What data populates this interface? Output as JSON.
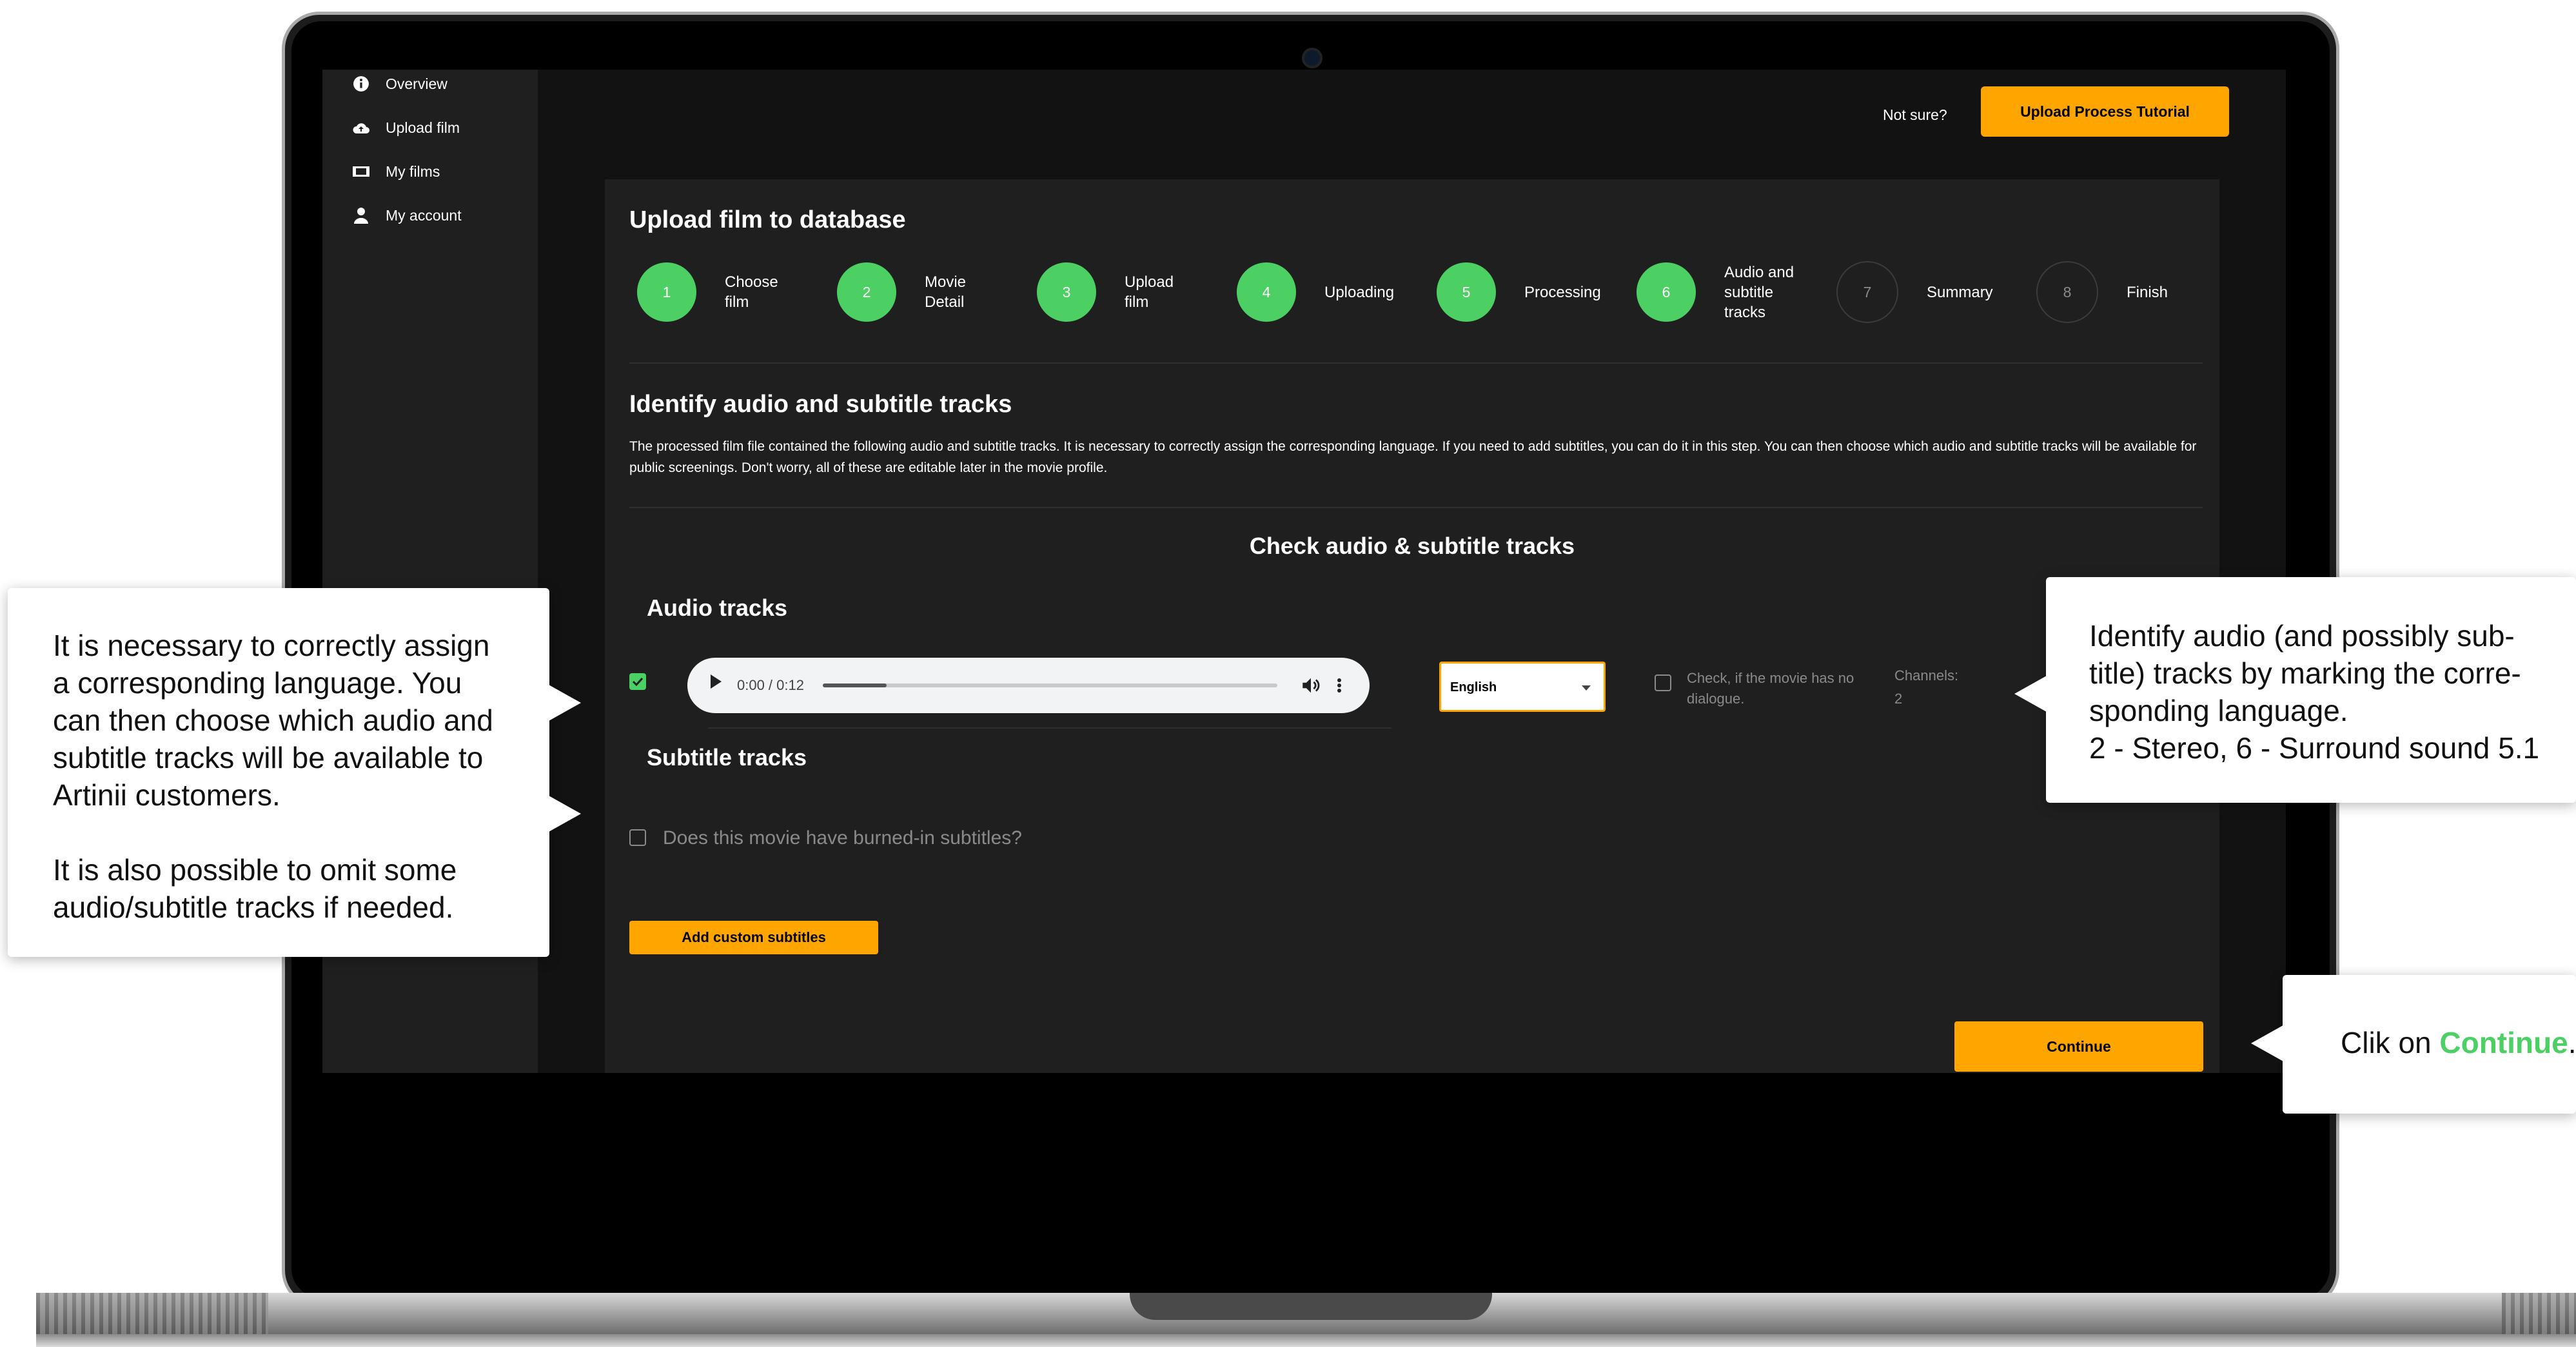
{
  "sidebar": {
    "items": [
      {
        "label": "Overview",
        "icon": "info-icon"
      },
      {
        "label": "Upload film",
        "icon": "cloud-upload-icon"
      },
      {
        "label": "My films",
        "icon": "film-icon"
      },
      {
        "label": "My account",
        "icon": "user-icon"
      }
    ]
  },
  "header": {
    "not_sure": "Not sure?",
    "tutorial_button": "Upload Process Tutorial"
  },
  "panel": {
    "title": "Upload film to database",
    "steps": [
      {
        "number": "1",
        "label": "Choose\nfilm",
        "status": "done"
      },
      {
        "number": "2",
        "label": "Movie\nDetail",
        "status": "done"
      },
      {
        "number": "3",
        "label": "Upload\nfilm",
        "status": "done"
      },
      {
        "number": "4",
        "label": "Uploading",
        "status": "done"
      },
      {
        "number": "5",
        "label": "Processing",
        "status": "done"
      },
      {
        "number": "6",
        "label": "Audio and\nsubtitle\ntracks",
        "status": "done"
      },
      {
        "number": "7",
        "label": "Summary",
        "status": "todo"
      },
      {
        "number": "8",
        "label": "Finish",
        "status": "todo"
      }
    ],
    "section_title": "Identify audio and subtitle tracks",
    "section_desc": "The processed film file contained the following audio and subtitle tracks. It is necessary to correctly assign the corresponding language. If you need to add subtitles, you can do it in this step. You can then choose which audio and subtitle tracks will be available for public screenings. Don't worry, all of these are editable later in the movie profile.",
    "check_title": "Check audio & subtitle tracks",
    "audio_heading": "Audio tracks",
    "audio_track": {
      "selected": true,
      "time": "0:00 / 0:12",
      "progress": 0.14,
      "language": "English",
      "no_dialogue_label": "Check, if the movie has no dialogue.",
      "channels_label": "Channels:",
      "channels_value": "2"
    },
    "subtitle_heading": "Subtitle tracks",
    "burned_in_label": "Does this movie have burned-in subtitles?",
    "add_subtitles_button": "Add custom subtitles",
    "continue_button": "Continue"
  },
  "callouts": {
    "left_p1": "It is necessary to correctly assign a corresponding language. You can then choose which audio and subtitle tracks will be available to Artinii customers.",
    "left_p2": "It is also possible to omit some audio/subtitle tracks if needed.",
    "right_lines": [
      "Identify audio (and possibly sub-",
      "title) tracks by marking the corre-",
      "sponding language.",
      "2 - Stereo, 6 - Surround sound 5.1"
    ],
    "continue_prefix": "Clik on ",
    "continue_word": "Continue",
    "continue_suffix": "."
  },
  "colors": {
    "accent_orange": "#ffa500",
    "step_green": "#4ccf63",
    "panel_bg": "#1f1f1f",
    "screen_bg": "#121212"
  }
}
